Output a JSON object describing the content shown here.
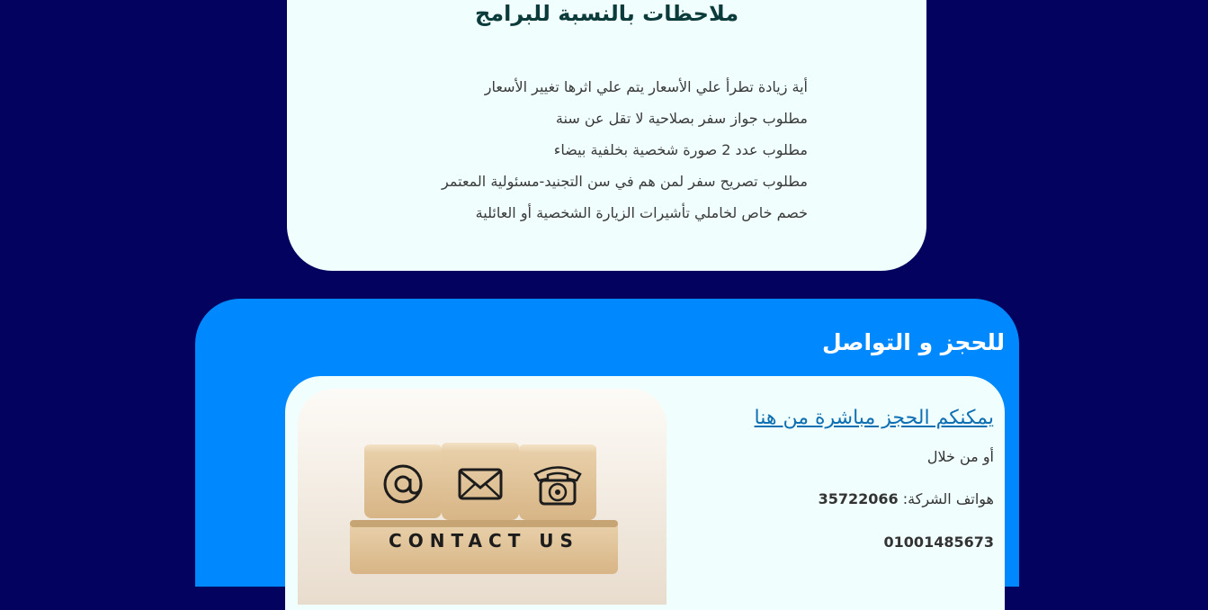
{
  "notes": {
    "title": "ملاحظات بالنسبة للبرامج",
    "items": [
      "أية زيادة تطرأ علي الأسعار يتم علي اثرها تغيير الأسعار",
      "مطلوب جواز سفر بصلاحية لا تقل عن سنة",
      "مطلوب عدد 2 صورة شخصية بخلفية بيضاء",
      "مطلوب تصريح سفر لمن هم في سن التجنيد-مسئولية المعتمر",
      "خصم خاص لخاملي تأشيرات الزيارة الشخصية أو العائلية"
    ]
  },
  "contact": {
    "heading": "للحجز و التواصل",
    "book_link": "يمكنكم الحجز مباشرة من هنا",
    "or_text": "أو من خلال",
    "phones_label": "هواتف الشركة:",
    "phone_1": "35722066",
    "phone_2": "01001485673",
    "image_text": "CONTACT US",
    "image_icons": [
      "at-sign-icon",
      "envelope-icon",
      "telephone-icon"
    ]
  },
  "colors": {
    "page_background": "#03035f",
    "notes_card": "#f0fffd",
    "contact_section": "#0088ff",
    "link": "#0f6fb3"
  }
}
